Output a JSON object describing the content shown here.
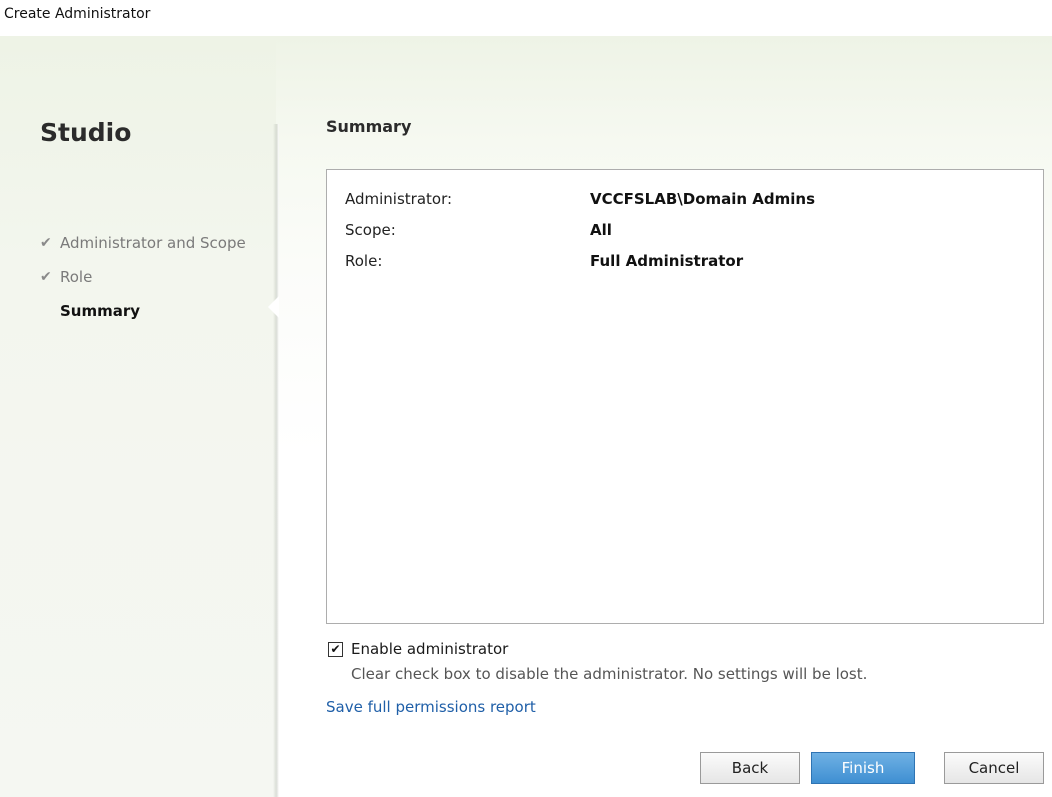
{
  "window": {
    "title": "Create Administrator"
  },
  "sidebar": {
    "brand": "Studio",
    "steps": [
      {
        "label": "Administrator and Scope",
        "status": "completed",
        "icon": "checkmark-icon"
      },
      {
        "label": "Role",
        "status": "completed",
        "icon": "checkmark-icon"
      },
      {
        "label": "Summary",
        "status": "current"
      }
    ]
  },
  "main": {
    "title": "Summary",
    "summary": [
      {
        "label": "Administrator:",
        "value": "VCCFSLAB\\Domain Admins"
      },
      {
        "label": "Scope:",
        "value": "All"
      },
      {
        "label": "Role:",
        "value": "Full Administrator"
      }
    ],
    "enable_checkbox": {
      "label": "Enable administrator",
      "checked": true,
      "check_glyph": "✔",
      "hint": "Clear check box to disable the administrator. No settings will be lost."
    },
    "report_link": "Save full permissions report"
  },
  "buttons": {
    "back": "Back",
    "finish": "Finish",
    "cancel": "Cancel"
  },
  "colors": {
    "link": "#1f5fa8",
    "primary_button": "#3f8fd2"
  }
}
